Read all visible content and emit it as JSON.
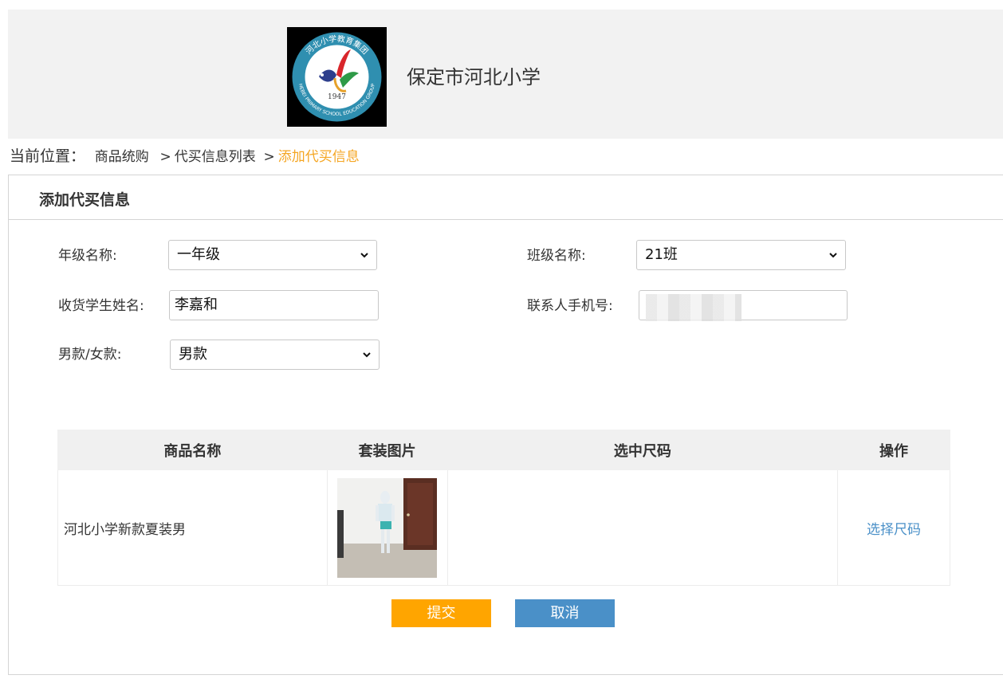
{
  "header": {
    "logo": {
      "ring_text": "河北小学教育集团",
      "ring_text_en": "HEBEI PRIMARY SCHOOL EDUCATION GROUP",
      "year": "1947"
    },
    "site_name": "保定市河北小学"
  },
  "breadcrumb": {
    "prefix": "当前位置：",
    "items": [
      "商品统购",
      "代买信息列表"
    ],
    "separator": ">",
    "current": "添加代买信息"
  },
  "form": {
    "title": "添加代买信息",
    "grade": {
      "label": "年级名称:",
      "value": "一年级"
    },
    "class": {
      "label": "班级名称:",
      "value": "21班"
    },
    "student_name": {
      "label": "收货学生姓名:",
      "value": "李嘉和"
    },
    "phone": {
      "label": "联系人手机号:",
      "value": ""
    },
    "gender": {
      "label": "男款/女款:",
      "value": "男款"
    }
  },
  "table": {
    "headers": [
      "商品名称",
      "套装图片",
      "选中尺码",
      "操作"
    ],
    "rows": [
      {
        "name": "河北小学新款夏装男",
        "image": "summer-uniform-photo",
        "selected_size": "",
        "action": "选择尺码"
      }
    ]
  },
  "buttons": {
    "submit": "提交",
    "cancel": "取消"
  },
  "colors": {
    "accent_orange": "#ffa500",
    "accent_blue": "#4a90c8",
    "breadcrumb_current": "#f5a623",
    "header_bg": "#f2f2f2"
  }
}
